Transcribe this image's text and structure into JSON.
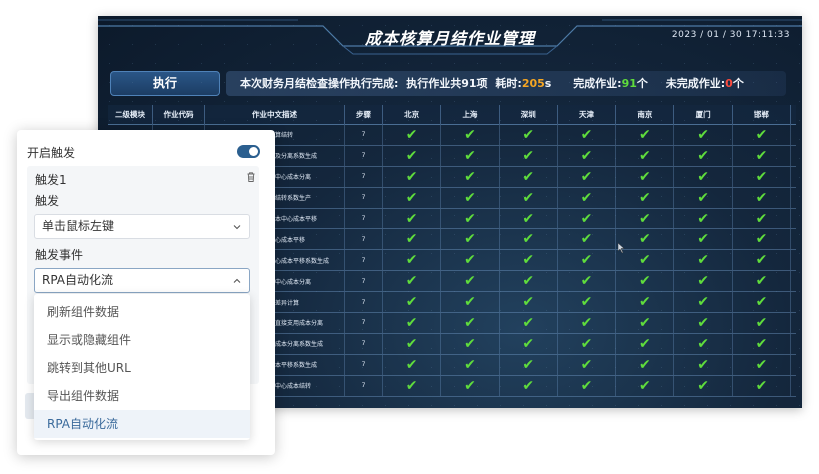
{
  "dashboard": {
    "title": "成本核算月结作业管理",
    "datetime": "2023 / 01 / 30 17:11:33",
    "exec_button": "执行",
    "status": {
      "prefix": "本次财务月结检查操作执行完成:",
      "total_label": "执行作业共91项",
      "time_label": "耗时:",
      "time_value": "205",
      "time_unit": "s",
      "done_label": "完成作业:",
      "done_value": "91",
      "done_unit": "个",
      "undone_label": "未完成作业:",
      "undone_value": "0",
      "undone_unit": "个"
    },
    "table": {
      "headers": [
        "二级模块",
        "作业代码",
        "作业中文描述",
        "步骤",
        "北京",
        "上海",
        "深圳",
        "天津",
        "南京",
        "厦门",
        "邯郸"
      ],
      "rows": [
        {
          "desc": "算结转",
          "step": "7"
        },
        {
          "desc": "及分离系数生成",
          "step": "7"
        },
        {
          "desc": "中心成本分离",
          "step": "7"
        },
        {
          "desc": "结转系数生产",
          "step": "7"
        },
        {
          "desc": "本中心成本平移",
          "step": "7"
        },
        {
          "desc": "心成本平移",
          "step": "7"
        },
        {
          "desc": "心成本平移系数生成",
          "step": "7"
        },
        {
          "desc": "中心成本分离",
          "step": "7"
        },
        {
          "desc": "差异计算",
          "step": "7"
        },
        {
          "desc": "直接支用成本分离",
          "step": "7"
        },
        {
          "desc": "成本分离系数生成",
          "step": "7"
        },
        {
          "desc": "本平移系数生成",
          "step": "7"
        },
        {
          "desc": "中心成本结转",
          "step": "7"
        }
      ],
      "check_glyph": "✔"
    }
  },
  "panel": {
    "enable_label": "开启触发",
    "trigger_title": "触发1",
    "trigger_label": "触发",
    "trigger_value": "单击鼠标左键",
    "event_label": "触发事件",
    "event_value": "RPA自动化流",
    "options": [
      "刷新组件数据",
      "显示或隐藏组件",
      "跳转到其他URL",
      "导出组件数据",
      "RPA自动化流"
    ],
    "selected_option": 4
  },
  "colors": {
    "accent": "#2b5f8f",
    "check": "#5fdc3c",
    "orange": "#f5a623",
    "red": "#ff4a3d"
  }
}
